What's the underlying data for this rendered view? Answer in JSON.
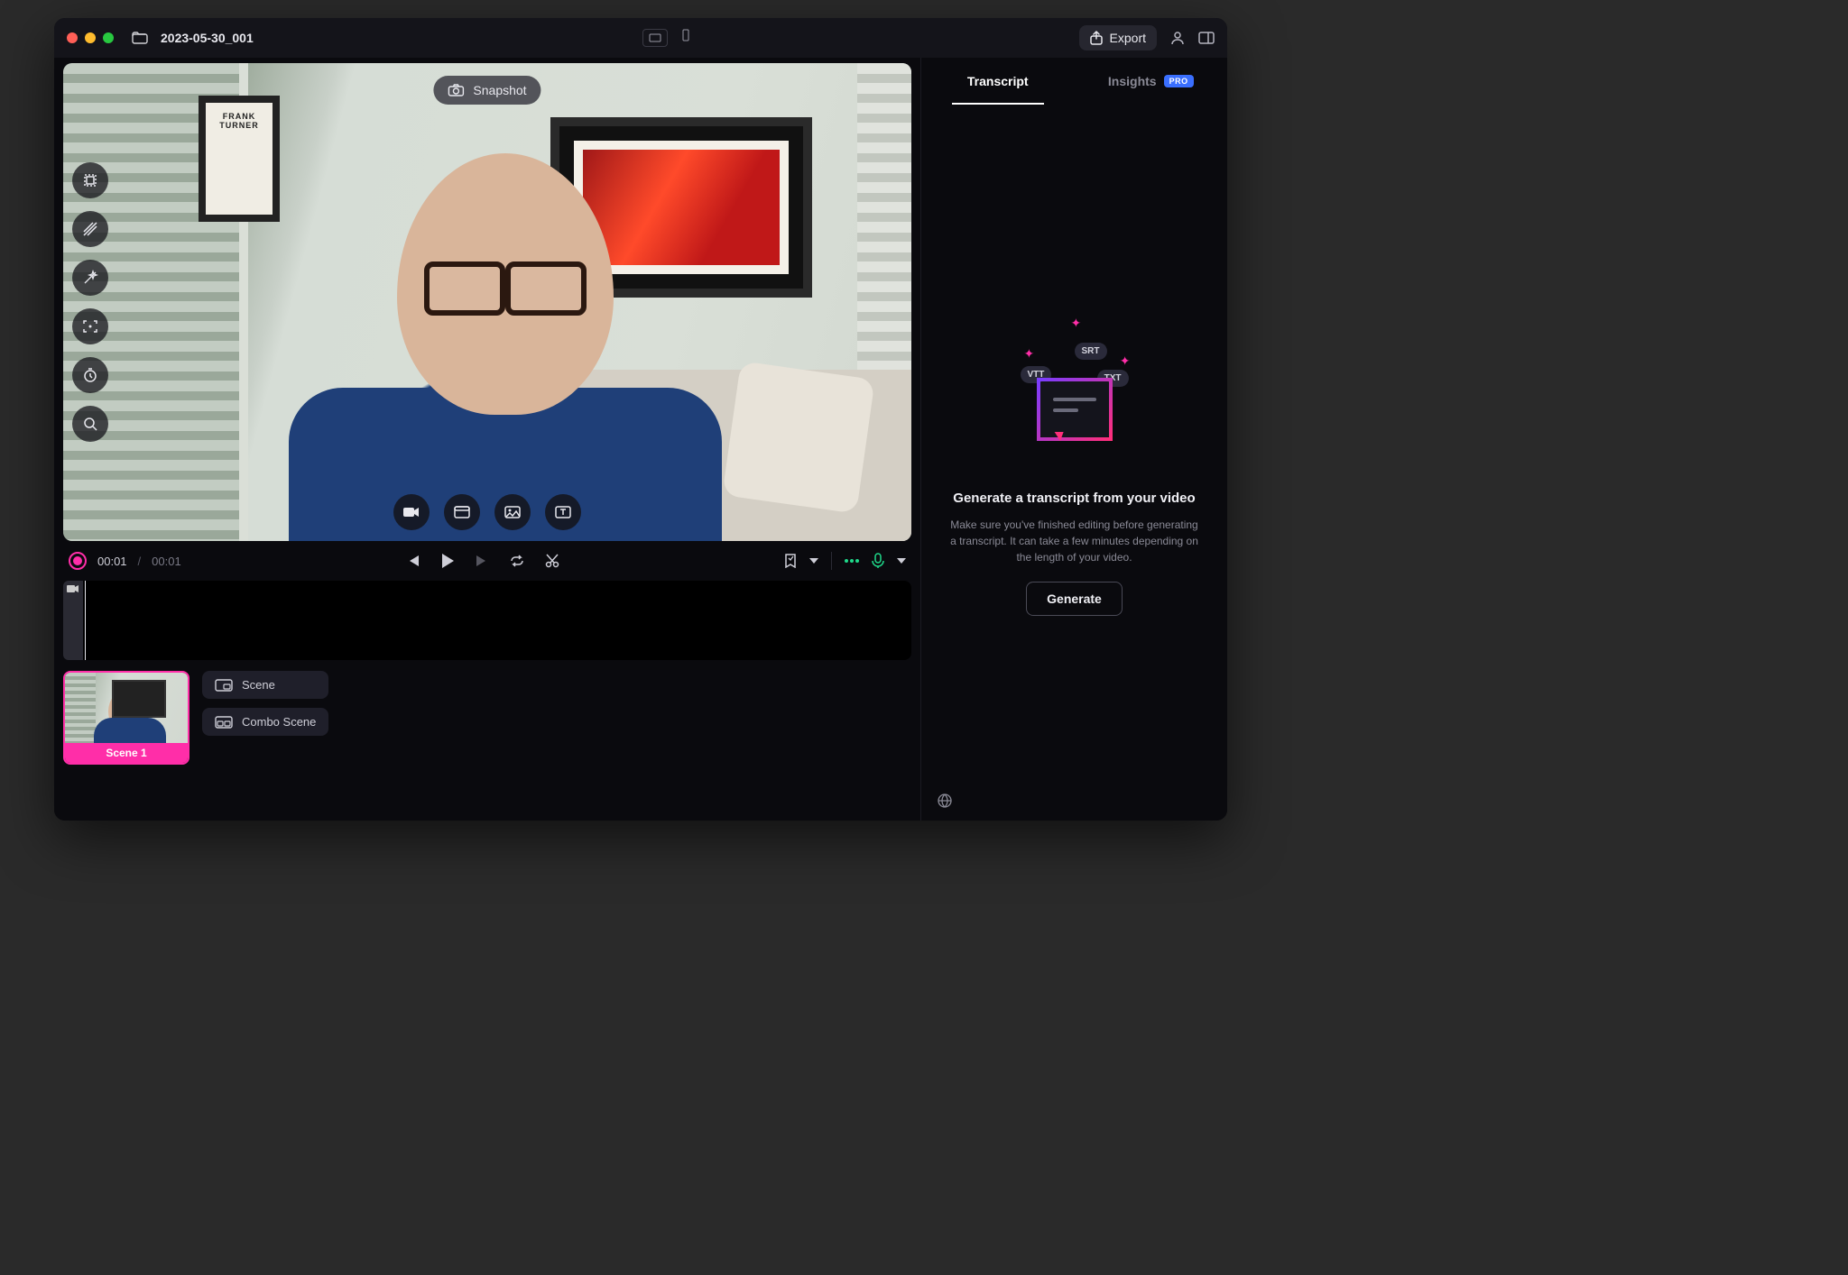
{
  "titlebar": {
    "project_name": "2023-05-30_001",
    "export_label": "Export"
  },
  "preview": {
    "snapshot_label": "Snapshot",
    "wall_frame_left_text": "FRANK TURNER"
  },
  "transport": {
    "current_time": "00:01",
    "total_time": "00:01"
  },
  "scenes": {
    "thumb_label": "Scene 1",
    "scene_btn": "Scene",
    "combo_btn": "Combo Scene"
  },
  "side": {
    "tabs": {
      "transcript": "Transcript",
      "insights": "Insights",
      "pro_badge": "PRO"
    },
    "badges": {
      "vtt": "VTT",
      "srt": "SRT",
      "txt": "TXT"
    },
    "heading": "Generate a transcript from your video",
    "description": "Make sure you've finished editing before generating a transcript. It can take a few minutes depending on the length of your video.",
    "generate_btn": "Generate"
  }
}
